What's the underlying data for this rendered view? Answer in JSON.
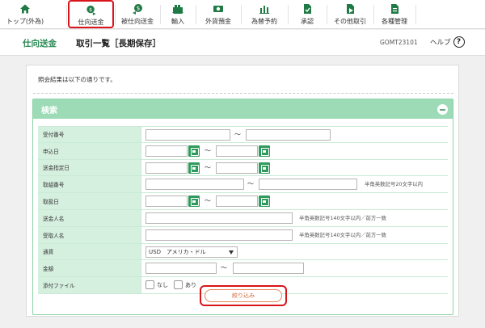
{
  "nav": {
    "items": [
      {
        "label": "トップ(外為)",
        "icon": "home-icon"
      },
      {
        "label": "仕向送金",
        "icon": "outward-remittance-icon"
      },
      {
        "label": "被仕向送金",
        "icon": "inward-remittance-icon"
      },
      {
        "label": "輸入",
        "icon": "import-icon"
      },
      {
        "label": "外貨預金",
        "icon": "foreign-deposit-icon"
      },
      {
        "label": "為替予約",
        "icon": "exchange-contract-icon"
      },
      {
        "label": "承認",
        "icon": "approval-icon"
      },
      {
        "label": "その他取引",
        "icon": "other-transactions-icon"
      },
      {
        "label": "各種管理",
        "icon": "management-icon"
      }
    ],
    "active_index": 1
  },
  "header": {
    "breadcrumb": "仕向送金",
    "title": "取引一覧［長期保存］",
    "screen_id": "GOMT23101",
    "help_label": "ヘルプ",
    "help_icon": "?"
  },
  "main": {
    "message": "照会結果は以下の通りです。"
  },
  "search": {
    "title": "検索",
    "fields": {
      "receipt_no": "受付番号",
      "apply_date": "申込日",
      "send_date": "送金指定日",
      "txn_no": "取組番号",
      "handle_date": "取扱日",
      "remitter": "送金人名",
      "beneficiary": "受取人名",
      "currency": "通貨",
      "amount": "金額",
      "attachment": "添付ファイル"
    },
    "tilde": "～",
    "notes": {
      "txn_no": "半角英数記号20文字以内",
      "remitter": "半角英数記号140文字以内／前方一致",
      "beneficiary": "半角英数記号140文字以内／前方一致"
    },
    "currency_selected": "USD　アメリカ・ドル",
    "attachment_options": [
      "なし",
      "あり"
    ],
    "submit_label": "絞り込み"
  },
  "colors": {
    "accent_green": "#2f9a5c",
    "panel_header": "#9ddbb7",
    "label_bg": "#d6f0e0",
    "highlight_red": "#d9141b"
  }
}
